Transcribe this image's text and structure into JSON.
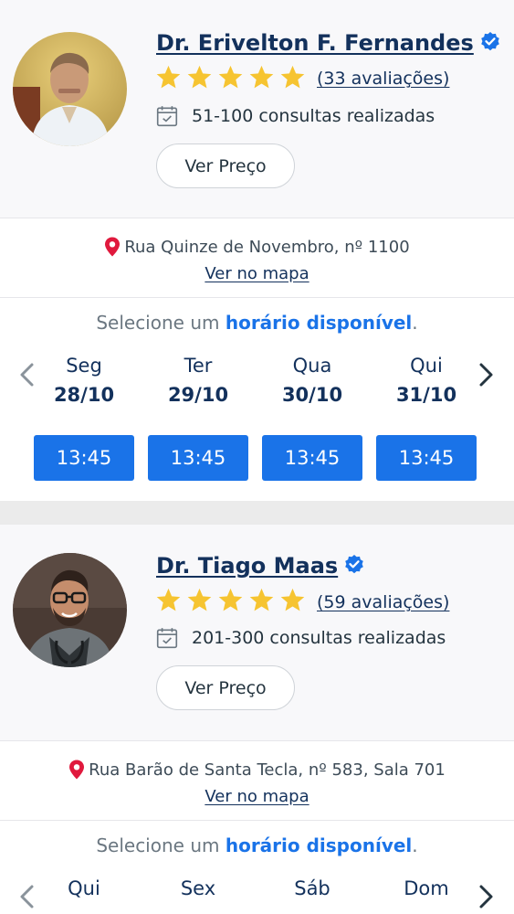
{
  "doctors": [
    {
      "name": "Dr. Erivelton F. Fernandes",
      "rating_stars": 5,
      "reviews": "(33 avaliações)",
      "consultations": "51-100 consultas realizadas",
      "price_button": "Ver Preço",
      "address": "Rua Quinze de Novembro, nº 1100",
      "map_link": "Ver no mapa",
      "select_prefix": "Selecione um ",
      "select_highlight": "horário disponível",
      "select_suffix": ".",
      "days": [
        {
          "name": "Seg",
          "date": "28/10",
          "slot": "13:45"
        },
        {
          "name": "Ter",
          "date": "29/10",
          "slot": "13:45"
        },
        {
          "name": "Qua",
          "date": "30/10",
          "slot": "13:45"
        },
        {
          "name": "Qui",
          "date": "31/10",
          "slot": "13:45"
        }
      ]
    },
    {
      "name": "Dr. Tiago Maas",
      "rating_stars": 5,
      "reviews": "(59 avaliações)",
      "consultations": "201-300 consultas realizadas",
      "price_button": "Ver Preço",
      "address": "Rua Barão de Santa Tecla, nº 583, Sala 701",
      "map_link": "Ver no mapa",
      "select_prefix": "Selecione um ",
      "select_highlight": "horário disponível",
      "select_suffix": ".",
      "days": [
        {
          "name": "Qui",
          "date": ""
        },
        {
          "name": "Sex",
          "date": ""
        },
        {
          "name": "Sáb",
          "date": ""
        },
        {
          "name": "Dom",
          "date": ""
        }
      ]
    }
  ],
  "colors": {
    "accent": "#1a73e8",
    "name_blue": "#13315c",
    "star": "#f6c431",
    "pin": "#e0193d"
  },
  "icons": {
    "verified": "verified-check-icon",
    "star": "star-icon",
    "calendar": "calendar-check-icon",
    "pin": "map-pin-icon",
    "prev": "chevron-left-icon",
    "next": "chevron-right-icon"
  }
}
